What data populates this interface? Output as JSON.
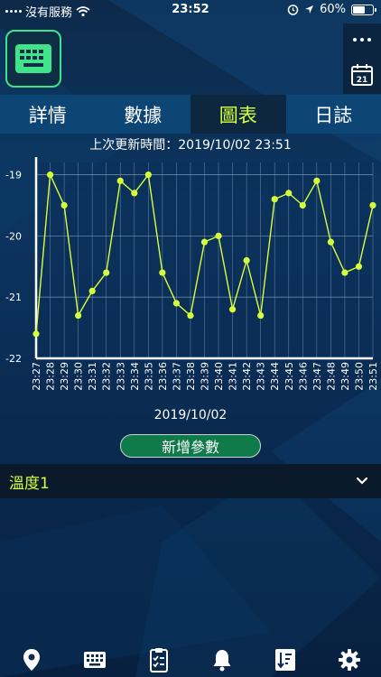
{
  "status_bar": {
    "carrier": "沒有服務",
    "time": "23:52",
    "battery": "60%",
    "battery_level": 0.6
  },
  "header": {
    "logo_icon": "keyboard-icon",
    "more_icon": "more-dots-icon",
    "calendar_icon": "calendar-icon",
    "calendar_number": "21"
  },
  "tabs": [
    {
      "label": "詳情",
      "active": false
    },
    {
      "label": "數據",
      "active": false
    },
    {
      "label": "圖表",
      "active": true
    },
    {
      "label": "日誌",
      "active": false
    }
  ],
  "last_update": "上次更新時間：2019/10/02 23:51",
  "chart_data": {
    "type": "line",
    "x": [
      "23:27",
      "23:28",
      "23:29",
      "23:30",
      "23:31",
      "23:32",
      "23:33",
      "23:34",
      "23:35",
      "23:36",
      "23:37",
      "23:38",
      "23:39",
      "23:40",
      "23:41",
      "23:42",
      "23:43",
      "23:44",
      "23:45",
      "23:46",
      "23:47",
      "23:48",
      "23:49",
      "23:50",
      "23:51"
    ],
    "series": [
      {
        "values": [
          -21.6,
          -19.0,
          -19.5,
          -21.3,
          -20.9,
          -20.6,
          -19.1,
          -19.3,
          -19.0,
          -20.6,
          -21.1,
          -21.3,
          -20.1,
          -20.0,
          -21.2,
          -20.4,
          -21.3,
          -19.4,
          -19.3,
          -19.5,
          -19.1,
          -20.1,
          -20.6,
          -20.5,
          -19.5
        ]
      }
    ],
    "yticks": [
      -19,
      -20,
      -21,
      -22
    ],
    "ylim": [
      -22,
      -18.8
    ],
    "grid": true,
    "line_color": "#d6ff3c",
    "grid_color": "#7e9ab8"
  },
  "chart_date": "2019/10/02",
  "add_param_label": "新增參數",
  "parameter": {
    "label": "溫度1"
  },
  "bottom_nav": [
    {
      "icon": "location-pin-icon"
    },
    {
      "icon": "keyboard-icon"
    },
    {
      "icon": "clipboard-checklist-icon"
    },
    {
      "icon": "bell-icon"
    },
    {
      "icon": "sort-list-icon"
    },
    {
      "icon": "gear-icon"
    }
  ],
  "colors": {
    "accent": "#d6ff3c",
    "logo_border": "#3fe38a",
    "button_green": "#0f7a4a",
    "tab_bar": "#0d4574",
    "tab_active": "#0d2740"
  }
}
